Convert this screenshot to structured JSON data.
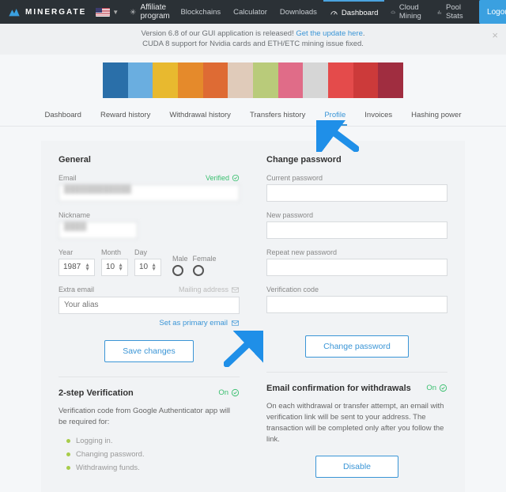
{
  "brand": "MINERGATE",
  "header": {
    "affiliate": "Affiliate program",
    "nav": {
      "blockchains": "Blockchains",
      "calculator": "Calculator",
      "downloads": "Downloads",
      "dashboard": "Dashboard",
      "cloud_mining": "Cloud Mining",
      "pool_stats": "Pool Stats"
    },
    "logout": "Logout"
  },
  "notice": {
    "line1_pre": "Version 6.8 of our GUI application is released! ",
    "line1_link": "Get the update here",
    "line2": "CUDA 8 support for Nvidia cards and ETH/ETC mining issue fixed."
  },
  "subtabs": {
    "dashboard": "Dashboard",
    "reward": "Reward history",
    "withdrawal": "Withdrawal history",
    "transfers": "Transfers history",
    "profile": "Profile",
    "invoices": "Invoices",
    "hashing": "Hashing power"
  },
  "general": {
    "heading": "General",
    "email_label": "Email",
    "verified": "Verified",
    "nickname_label": "Nickname",
    "year_label": "Year",
    "month_label": "Month",
    "day_label": "Day",
    "year_val": "1987",
    "month_val": "10",
    "day_val": "10",
    "male": "Male",
    "female": "Female",
    "extra_email_label": "Extra email",
    "extra_email_placeholder": "Your alias",
    "mailing_address": "Mailing address",
    "set_primary": "Set as primary email",
    "save": "Save changes"
  },
  "change_pw": {
    "heading": "Change password",
    "current": "Current password",
    "new": "New password",
    "repeat": "Repeat new password",
    "verification": "Verification code",
    "button": "Change password"
  },
  "twostep": {
    "heading": "2-step Verification",
    "status": "On",
    "desc": "Verification code from Google Authenticator app will be required for:",
    "b1": "Logging in.",
    "b2": "Changing password.",
    "b3": "Withdrawing funds."
  },
  "email_conf": {
    "heading": "Email confirmation for withdrawals",
    "status": "On",
    "desc": "On each withdrawal or transfer attempt, an email with verification link will be sent to your address. The transaction will be completed only after you follow the link.",
    "disable": "Disable"
  }
}
